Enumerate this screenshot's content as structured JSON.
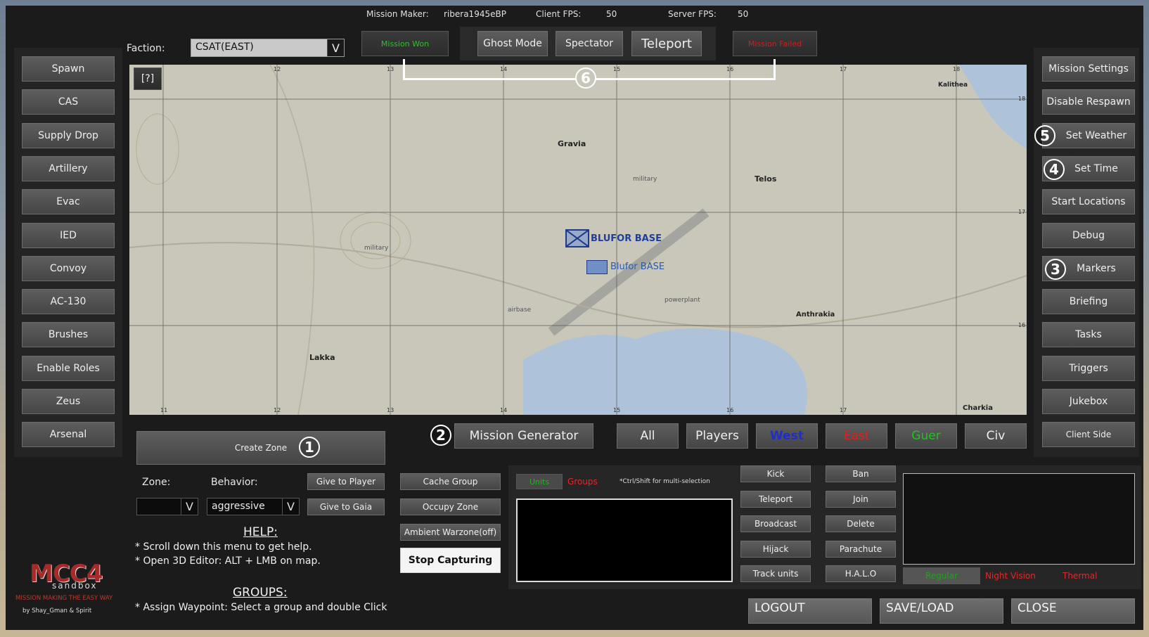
{
  "topbar": {
    "mission_maker_label": "Mission Maker:",
    "mission_maker_value": "ribera1945eBP",
    "client_fps_label": "Client FPS:",
    "client_fps_value": "50",
    "server_fps_label": "Server FPS:",
    "server_fps_value": "50"
  },
  "faction": {
    "label": "Faction:",
    "value": "CSAT(EAST)",
    "arrow": "V"
  },
  "top_buttons": {
    "mission_won": "Mission Won",
    "ghost_mode": "Ghost Mode",
    "spectator": "Spectator",
    "teleport": "Teleport",
    "mission_failed": "Mission Failed"
  },
  "left_menu": [
    "Spawn",
    "CAS",
    "Supply Drop",
    "Artillery",
    "Evac",
    "IED",
    "Convoy",
    "AC-130",
    "Brushes",
    "Enable Roles",
    "Zeus",
    "Arsenal"
  ],
  "right_menu": [
    "Mission Settings",
    "Disable Respawn",
    "Set Weather",
    "Set Time",
    "Start Locations",
    "Debug",
    "Markers",
    "Briefing",
    "Tasks",
    "Triggers",
    "Jukebox",
    "Client Side"
  ],
  "numbers": {
    "n1": "1",
    "n2": "2",
    "n3": "3",
    "n4": "4",
    "n5": "5",
    "n6": "6"
  },
  "map": {
    "help_button": "[?]",
    "towns": [
      "Gravia",
      "Telos",
      "Lakka",
      "Kalithea",
      "Anthrakia",
      "Charkia"
    ],
    "small_labels": [
      "military",
      "military",
      "airbase",
      "powerplant"
    ],
    "markers": [
      "BLUFOR BASE",
      "Blufor BASE"
    ],
    "grid_top": [
      "12",
      "13",
      "14",
      "15",
      "16",
      "17",
      "18"
    ],
    "grid_bottom": [
      "11",
      "12",
      "13",
      "14",
      "15",
      "16",
      "17"
    ],
    "grid_side": [
      "18",
      "17",
      "16"
    ]
  },
  "create_zone": "Create Zone",
  "zone": {
    "zone_label": "Zone:",
    "behavior_label": "Behavior:",
    "zone_value": "",
    "behavior_value": "aggressive",
    "arrow": "V",
    "give_player": "Give to Player",
    "give_gaia": "Give to Gaia"
  },
  "mission_generator": "Mission Generator",
  "filters": {
    "all": "All",
    "players": "Players",
    "west": "West",
    "east": "East",
    "guer": "Guer",
    "civ": "Civ",
    "west_color": "#1e2fc8",
    "east_color": "#e02020",
    "guer_color": "#22c022"
  },
  "client_side": "Client Side",
  "middle_actions": {
    "cache_group": "Cache Group",
    "occupy_zone": "Occupy Zone",
    "ambient": "Ambient Warzone(off)",
    "stop_capturing": "Stop Capturing"
  },
  "help": {
    "title": "HELP:",
    "lines": [
      "* Scroll down this menu to get help.",
      "* Open 3D Editor: ALT + LMB on map."
    ],
    "groups_title": "GROUPS:",
    "groups_lines": [
      "* Assign Waypoint: Select a group and double Click"
    ]
  },
  "units_panel": {
    "units_tab": "Units",
    "groups_tab": "Groups",
    "hint": "*Ctrl/Shift for multi-selection"
  },
  "unit_actions": {
    "col1": [
      "Kick",
      "Teleport",
      "Broadcast",
      "Hijack",
      "Track units"
    ],
    "col2": [
      "Ban",
      "Join",
      "Delete",
      "Parachute",
      "H.A.L.O"
    ]
  },
  "vision": {
    "regular": "Regular",
    "night": "Night Vision",
    "thermal": "Thermal"
  },
  "footer": {
    "logout": "LOGOUT",
    "save_load": "SAVE/LOAD",
    "close": "CLOSE"
  },
  "logo": {
    "title": "MCC4",
    "subtitle": "sandbox",
    "tagline": "MISSION MAKING THE EASY WAY",
    "credit": "by Shay_Gman & Spirit"
  }
}
